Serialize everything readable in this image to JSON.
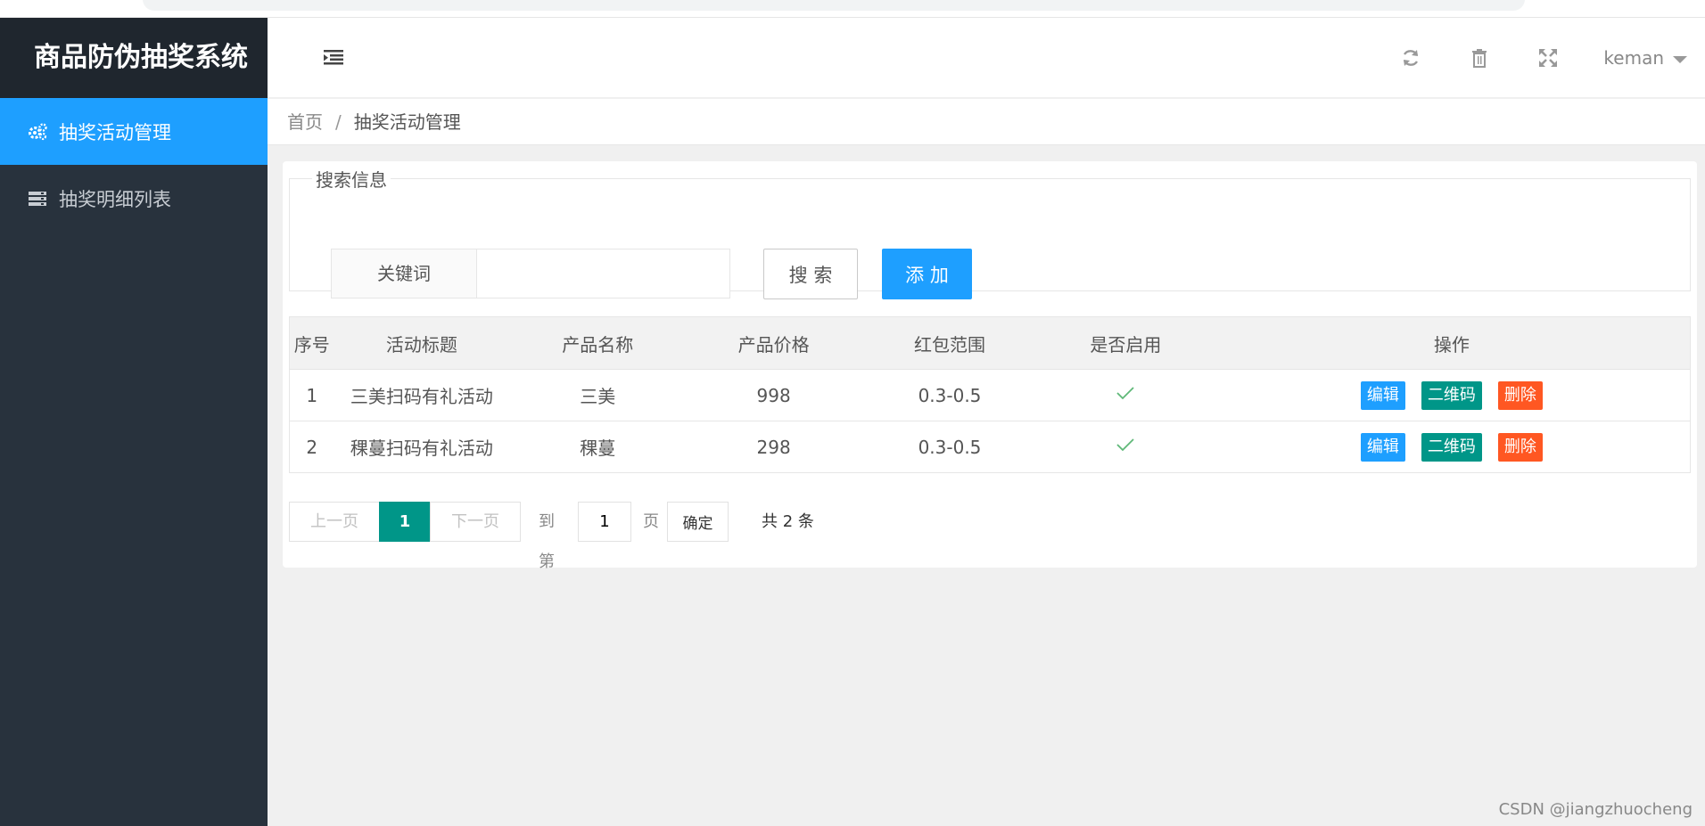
{
  "app": {
    "title": "商品防伪抽奖系统"
  },
  "sidebar": {
    "items": [
      {
        "label": "抽奖活动管理",
        "icon": "gears-icon",
        "active": true
      },
      {
        "label": "抽奖明细列表",
        "icon": "server-list-icon",
        "active": false
      }
    ]
  },
  "header": {
    "icons": [
      "refresh-icon",
      "trash-icon",
      "fullscreen-icon"
    ],
    "user": "keman"
  },
  "breadcrumb": {
    "home": "首页",
    "separator": "/",
    "current": "抽奖活动管理"
  },
  "search": {
    "legend": "搜索信息",
    "keyword_label": "关键词",
    "keyword_value": "",
    "search_button": "搜 索",
    "add_button": "添 加"
  },
  "table": {
    "columns": [
      "序号",
      "活动标题",
      "产品名称",
      "产品价格",
      "红包范围",
      "是否启用",
      "操作"
    ],
    "rows": [
      {
        "no": "1",
        "title": "三美扫码有礼活动",
        "product": "三美",
        "price": "998",
        "range": "0.3-0.5",
        "enabled": true
      },
      {
        "no": "2",
        "title": "稞蔓扫码有礼活动",
        "product": "稞蔓",
        "price": "298",
        "range": "0.3-0.5",
        "enabled": true
      }
    ],
    "actions": {
      "edit": "编辑",
      "qr": "二维码",
      "delete": "删除"
    }
  },
  "pager": {
    "prev": "上一页",
    "current": "1",
    "next": "下一页",
    "goto_prefix": "到第",
    "goto_value": "1",
    "goto_suffix": "页",
    "confirm": "确定",
    "total": "共 2 条"
  },
  "watermark": "CSDN @jiangzhuocheng",
  "colors": {
    "sidebar_bg": "#28323d",
    "logo_bg": "#1f262e",
    "active_blue": "#1e9fff",
    "teal": "#009688",
    "danger": "#ff5722"
  }
}
